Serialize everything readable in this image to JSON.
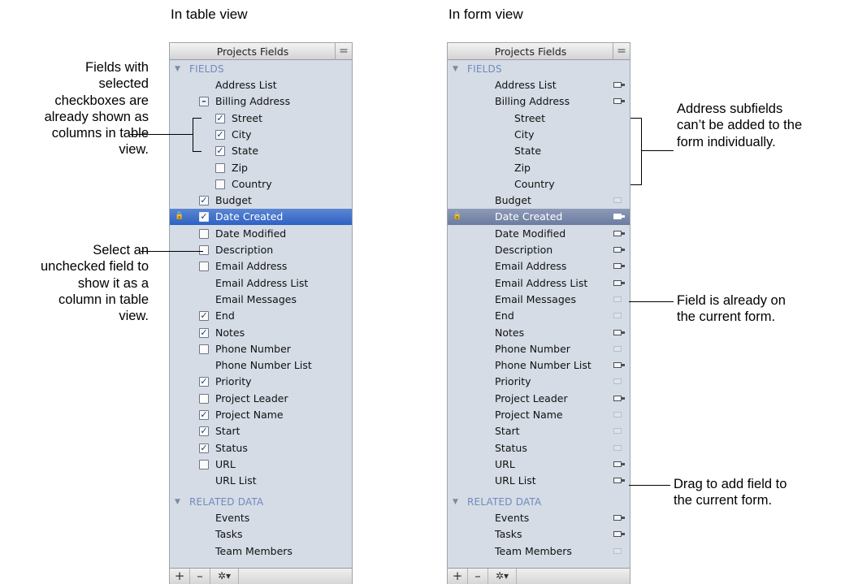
{
  "captions": {
    "table_view": "In table view",
    "form_view": "In form view"
  },
  "panel": {
    "title": "Projects Fields",
    "fields_header": "FIELDS",
    "related_header": "RELATED DATA",
    "footer": {
      "add": "+",
      "remove": "–",
      "gear": "✲▾"
    }
  },
  "table_rows": [
    {
      "label": "Address List",
      "check": "none",
      "indent": 0
    },
    {
      "label": "Billing Address",
      "check": "minus",
      "indent": 0
    },
    {
      "label": "Street",
      "check": "checked",
      "indent": 1
    },
    {
      "label": "City",
      "check": "checked",
      "indent": 1
    },
    {
      "label": "State",
      "check": "checked",
      "indent": 1
    },
    {
      "label": "Zip",
      "check": "unchecked",
      "indent": 1
    },
    {
      "label": "Country",
      "check": "unchecked",
      "indent": 1
    },
    {
      "label": "Budget",
      "check": "checked",
      "indent": 0
    },
    {
      "label": "Date Created",
      "check": "checked",
      "indent": 0,
      "selected": true,
      "lock": true
    },
    {
      "label": "Date Modified",
      "check": "unchecked",
      "indent": 0
    },
    {
      "label": "Description",
      "check": "unchecked",
      "indent": 0
    },
    {
      "label": "Email Address",
      "check": "unchecked",
      "indent": 0
    },
    {
      "label": "Email Address List",
      "check": "none",
      "indent": 0
    },
    {
      "label": "Email Messages",
      "check": "none",
      "indent": 0
    },
    {
      "label": "End",
      "check": "checked",
      "indent": 0
    },
    {
      "label": "Notes",
      "check": "checked",
      "indent": 0
    },
    {
      "label": "Phone Number",
      "check": "unchecked",
      "indent": 0
    },
    {
      "label": "Phone Number List",
      "check": "none",
      "indent": 0
    },
    {
      "label": "Priority",
      "check": "checked",
      "indent": 0
    },
    {
      "label": "Project Leader",
      "check": "unchecked",
      "indent": 0
    },
    {
      "label": "Project Name",
      "check": "checked",
      "indent": 0
    },
    {
      "label": "Start",
      "check": "checked",
      "indent": 0
    },
    {
      "label": "Status",
      "check": "checked",
      "indent": 0
    },
    {
      "label": "URL",
      "check": "unchecked",
      "indent": 0
    },
    {
      "label": "URL List",
      "check": "none",
      "indent": 0
    }
  ],
  "table_related": [
    "Events",
    "Tasks",
    "Team Members"
  ],
  "form_rows": [
    {
      "label": "Address List",
      "icon": "add",
      "indent": 0
    },
    {
      "label": "Billing Address",
      "icon": "add",
      "indent": 0
    },
    {
      "label": "Street",
      "icon": "none",
      "indent": 1
    },
    {
      "label": "City",
      "icon": "none",
      "indent": 1
    },
    {
      "label": "State",
      "icon": "none",
      "indent": 1
    },
    {
      "label": "Zip",
      "icon": "none",
      "indent": 1
    },
    {
      "label": "Country",
      "icon": "none",
      "indent": 1
    },
    {
      "label": "Budget",
      "icon": "dim",
      "indent": 0
    },
    {
      "label": "Date Created",
      "icon": "add",
      "indent": 0,
      "selected": true,
      "lock": true
    },
    {
      "label": "Date Modified",
      "icon": "add",
      "indent": 0
    },
    {
      "label": "Description",
      "icon": "add",
      "indent": 0
    },
    {
      "label": "Email Address",
      "icon": "add",
      "indent": 0
    },
    {
      "label": "Email Address List",
      "icon": "add",
      "indent": 0
    },
    {
      "label": "Email Messages",
      "icon": "dim",
      "indent": 0
    },
    {
      "label": "End",
      "icon": "dim",
      "indent": 0
    },
    {
      "label": "Notes",
      "icon": "add",
      "indent": 0
    },
    {
      "label": "Phone Number",
      "icon": "dim",
      "indent": 0
    },
    {
      "label": "Phone Number List",
      "icon": "add",
      "indent": 0
    },
    {
      "label": "Priority",
      "icon": "dim",
      "indent": 0
    },
    {
      "label": "Project Leader",
      "icon": "add",
      "indent": 0
    },
    {
      "label": "Project Name",
      "icon": "dim",
      "indent": 0
    },
    {
      "label": "Start",
      "icon": "dim",
      "indent": 0
    },
    {
      "label": "Status",
      "icon": "dim",
      "indent": 0
    },
    {
      "label": "URL",
      "icon": "add",
      "indent": 0
    },
    {
      "label": "URL List",
      "icon": "add",
      "indent": 0
    }
  ],
  "form_related": [
    {
      "label": "Events",
      "icon": "add"
    },
    {
      "label": "Tasks",
      "icon": "add"
    },
    {
      "label": "Team Members",
      "icon": "dim"
    }
  ],
  "callouts": {
    "checkboxes": [
      "Fields with",
      "selected",
      "checkboxes are",
      "already shown as",
      "columns in table",
      "view."
    ],
    "unchecked": [
      "Select an",
      "unchecked field to",
      "show it as a",
      "column in table",
      "view."
    ],
    "subfields": [
      "Address subfields",
      "can’t be added to the",
      "form individually."
    ],
    "on_form": [
      "Field is already on",
      "the current form."
    ],
    "drag": [
      "Drag to add field to",
      "the current form."
    ]
  },
  "colors": {
    "panel_bg": "#d5dce6",
    "selection": "#2f61c4",
    "section_header": "#7189bd"
  }
}
